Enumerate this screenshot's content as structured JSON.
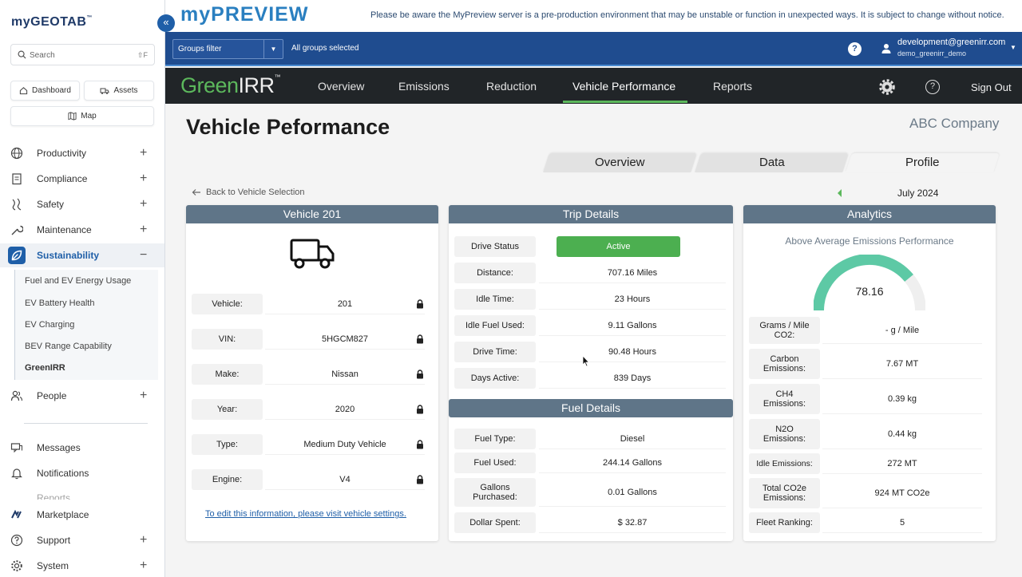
{
  "sidebar": {
    "logo": "myGEOTAB",
    "search_placeholder": "Search",
    "search_shortcut": "⇧F",
    "quick": {
      "dashboard": "Dashboard",
      "assets": "Assets",
      "map": "Map"
    },
    "nav": [
      {
        "label": "Productivity",
        "icon": "globe-icon"
      },
      {
        "label": "Compliance",
        "icon": "clipboard-icon"
      },
      {
        "label": "Safety",
        "icon": "road-icon"
      },
      {
        "label": "Maintenance",
        "icon": "wrench-icon"
      },
      {
        "label": "Sustainability",
        "icon": "leaf-icon"
      }
    ],
    "sub_items": [
      "Fuel and EV Energy Usage",
      "EV Battery Health",
      "EV Charging",
      "BEV Range Capability",
      "GreenIRR"
    ],
    "people": "People",
    "messages": "Messages",
    "notifications": "Notifications",
    "reports_partial": "Reports",
    "marketplace": "Marketplace",
    "support": "Support",
    "system": "System"
  },
  "banner": {
    "logo_a": "my",
    "logo_b": "PREVIEW",
    "notice": "Please be aware the MyPreview server is a pre-production environment that may be unstable or function in unexpected ways. It is subject to change without notice."
  },
  "groups_bar": {
    "filter_label": "Groups filter",
    "selected": "All groups selected",
    "user_email": "development@greenirr.com",
    "user_db": "demo_greenirr_demo"
  },
  "app_nav": {
    "logo_green": "Green",
    "logo_irr": "IRR",
    "tabs": [
      "Overview",
      "Emissions",
      "Reduction",
      "Vehicle Performance",
      "Reports"
    ],
    "active_tab": "Vehicle Performance",
    "sign_out": "Sign Out"
  },
  "page": {
    "title": "Vehicle Peformance",
    "company": "ABC Company",
    "tabs": [
      "Overview",
      "Data",
      "Profile"
    ],
    "active_tab": "Profile",
    "back": "Back to Vehicle Selection",
    "month": "July 2024"
  },
  "vehicle": {
    "heading": "Vehicle 201",
    "rows": [
      {
        "label": "Vehicle:",
        "value": "201"
      },
      {
        "label": "VIN:",
        "value": "5HGCM827"
      },
      {
        "label": "Make:",
        "value": "Nissan"
      },
      {
        "label": "Year:",
        "value": "2020"
      },
      {
        "label": "Type:",
        "value": "Medium Duty Vehicle"
      },
      {
        "label": "Engine:",
        "value": "V4"
      }
    ],
    "edit_link": "To edit this information, please visit vehicle settings."
  },
  "trip": {
    "heading": "Trip Details",
    "drive_status_label": "Drive Status",
    "drive_status": "Active",
    "rows": [
      {
        "label": "Distance:",
        "value": "707.16 Miles"
      },
      {
        "label": "Idle Time:",
        "value": "23 Hours"
      },
      {
        "label": "Idle Fuel Used:",
        "value": "9.11 Gallons"
      },
      {
        "label": "Drive Time:",
        "value": "90.48 Hours"
      },
      {
        "label": "Days Active:",
        "value": "839 Days"
      }
    ]
  },
  "fuel": {
    "heading": "Fuel Details",
    "rows": [
      {
        "label": "Fuel Type:",
        "value": "Diesel"
      },
      {
        "label": "Fuel Used:",
        "value": "244.14 Gallons"
      },
      {
        "label": "Gallons Purchased:",
        "value": "0.01 Gallons"
      },
      {
        "label": "Dollar Spent:",
        "value": "$ 32.87"
      }
    ]
  },
  "analytics": {
    "heading": "Analytics",
    "subtitle": "Above Average Emissions Performance",
    "gauge_value": "78.16",
    "gauge_fraction": 0.7816,
    "gauge_color": "#5dc9a5",
    "rows": [
      {
        "label": "Grams / Mile CO2:",
        "value": "- g / Mile"
      },
      {
        "label": "Carbon Emissions:",
        "value": "7.67 MT"
      },
      {
        "label": "CH4 Emissions:",
        "value": "0.39 kg"
      },
      {
        "label": "N2O Emissions:",
        "value": "0.44 kg"
      },
      {
        "label": "Idle Emissions:",
        "value": "272 MT"
      },
      {
        "label": "Total CO2e Emissions:",
        "value": "924 MT CO2e"
      },
      {
        "label": "Fleet Ranking:",
        "value": "5"
      }
    ]
  },
  "colors": {
    "brand_green": "#5cb85c",
    "header_blue": "#1f4c8f",
    "panel_head": "#5f7588",
    "active_green": "#4caf50"
  }
}
